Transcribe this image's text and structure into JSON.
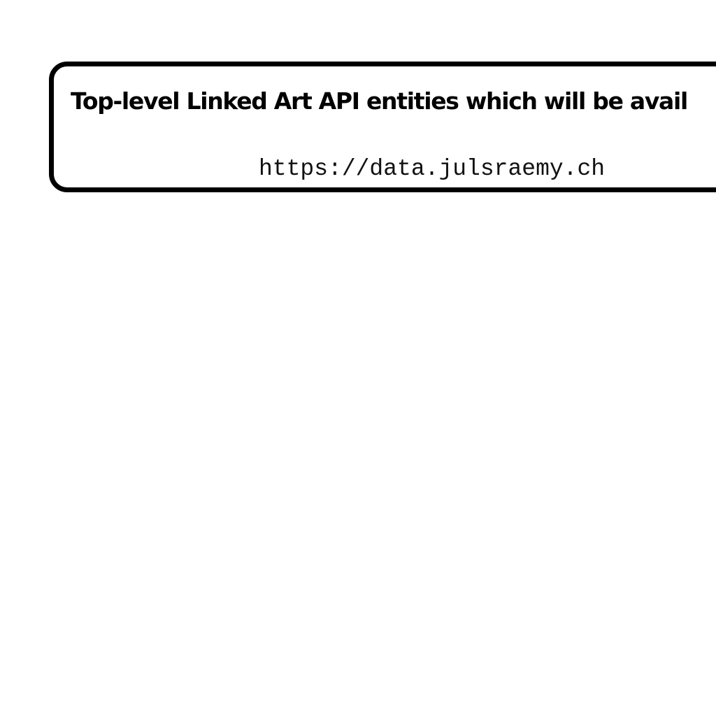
{
  "header_box": {
    "title": "Top-level Linked Art API entities which will be avail",
    "url": "https://data.julsraemy.ch"
  },
  "colors": {
    "background": "#ffffff",
    "border": "#000000",
    "text": "#000000"
  }
}
